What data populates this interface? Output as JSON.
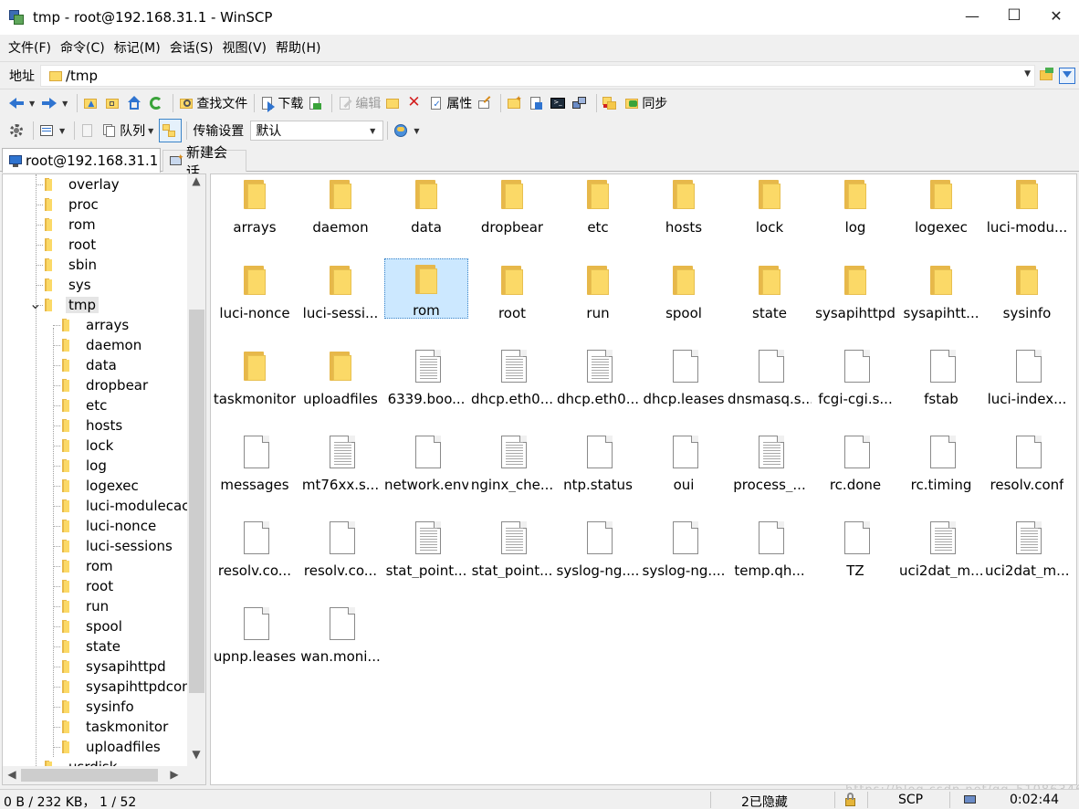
{
  "window": {
    "title": "tmp - root@192.168.31.1 - WinSCP",
    "minimize_glyph": "—",
    "maximize_glyph": "☐",
    "close_glyph": "✕"
  },
  "menu": [
    "文件(F)",
    "命令(C)",
    "标记(M)",
    "会话(S)",
    "视图(V)",
    "帮助(H)"
  ],
  "address": {
    "label": "地址",
    "value": "/tmp"
  },
  "toolbar1": {
    "find_files": "查找文件",
    "download": "下载",
    "edit": "编辑",
    "properties": "属性",
    "sync": "同步"
  },
  "toolbar2": {
    "queue": "队列",
    "transfer_settings": "传输设置",
    "transfer_preset": "默认"
  },
  "tabs": {
    "session": "root@192.168.31.1",
    "new_session": "新建会话"
  },
  "tree": {
    "top_items": [
      "overlay",
      "proc",
      "rom",
      "root",
      "sbin",
      "sys"
    ],
    "selected": "tmp",
    "children": [
      "arrays",
      "daemon",
      "data",
      "dropbear",
      "etc",
      "hosts",
      "lock",
      "log",
      "logexec",
      "luci-modulecache",
      "luci-nonce",
      "luci-sessions",
      "rom",
      "root",
      "run",
      "spool",
      "state",
      "sysapihttpd",
      "sysapihttpdconf",
      "sysinfo",
      "taskmonitor",
      "uploadfiles"
    ],
    "after": "usrdisk"
  },
  "files": [
    {
      "name": "arrays",
      "type": "folder"
    },
    {
      "name": "daemon",
      "type": "folder"
    },
    {
      "name": "data",
      "type": "folder"
    },
    {
      "name": "dropbear",
      "type": "folder"
    },
    {
      "name": "etc",
      "type": "folder"
    },
    {
      "name": "hosts",
      "type": "folder"
    },
    {
      "name": "lock",
      "type": "folder"
    },
    {
      "name": "log",
      "type": "folder"
    },
    {
      "name": "logexec",
      "type": "folder"
    },
    {
      "name": "luci-modu...",
      "type": "folder"
    },
    {
      "name": "luci-nonce",
      "type": "folder"
    },
    {
      "name": "luci-sessi...",
      "type": "folder"
    },
    {
      "name": "rom",
      "type": "folder",
      "selected": true
    },
    {
      "name": "root",
      "type": "folder"
    },
    {
      "name": "run",
      "type": "folder"
    },
    {
      "name": "spool",
      "type": "folder"
    },
    {
      "name": "state",
      "type": "folder"
    },
    {
      "name": "sysapihttpd",
      "type": "folder"
    },
    {
      "name": "sysapihtt...",
      "type": "folder"
    },
    {
      "name": "sysinfo",
      "type": "folder"
    },
    {
      "name": "taskmonitor",
      "type": "folder"
    },
    {
      "name": "uploadfiles",
      "type": "folder"
    },
    {
      "name": "6339.boo...",
      "type": "text"
    },
    {
      "name": "dhcp.eth0...",
      "type": "text"
    },
    {
      "name": "dhcp.eth0...",
      "type": "text"
    },
    {
      "name": "dhcp.leases",
      "type": "blank"
    },
    {
      "name": "dnsmasq.s...",
      "type": "blank"
    },
    {
      "name": "fcgi-cgi.s...",
      "type": "blank"
    },
    {
      "name": "fstab",
      "type": "blank"
    },
    {
      "name": "luci-index...",
      "type": "blank"
    },
    {
      "name": "messages",
      "type": "blank"
    },
    {
      "name": "mt76xx.s...",
      "type": "text"
    },
    {
      "name": "network.env",
      "type": "blank"
    },
    {
      "name": "nginx_che...",
      "type": "text"
    },
    {
      "name": "ntp.status",
      "type": "blank"
    },
    {
      "name": "oui",
      "type": "blank"
    },
    {
      "name": "process_...",
      "type": "text"
    },
    {
      "name": "rc.done",
      "type": "blank"
    },
    {
      "name": "rc.timing",
      "type": "blank"
    },
    {
      "name": "resolv.conf",
      "type": "blank"
    },
    {
      "name": "resolv.co...",
      "type": "blank"
    },
    {
      "name": "resolv.co...",
      "type": "blank"
    },
    {
      "name": "stat_point...",
      "type": "text"
    },
    {
      "name": "stat_point...",
      "type": "text"
    },
    {
      "name": "syslog-ng....",
      "type": "blank"
    },
    {
      "name": "syslog-ng....",
      "type": "blank"
    },
    {
      "name": "temp.qh...",
      "type": "blank"
    },
    {
      "name": "TZ",
      "type": "blank"
    },
    {
      "name": "uci2dat_m...",
      "type": "text"
    },
    {
      "name": "uci2dat_m...",
      "type": "text"
    },
    {
      "name": "upnp.leases",
      "type": "blank"
    },
    {
      "name": "wan.moni...",
      "type": "blank"
    }
  ],
  "status": {
    "selection": "0 B / 232 KB， 1 / 52",
    "hidden": "2已隐藏",
    "protocol": "SCP",
    "time": "0:02:44"
  },
  "watermark": "https://blog.csdn.net/qq_51086346"
}
